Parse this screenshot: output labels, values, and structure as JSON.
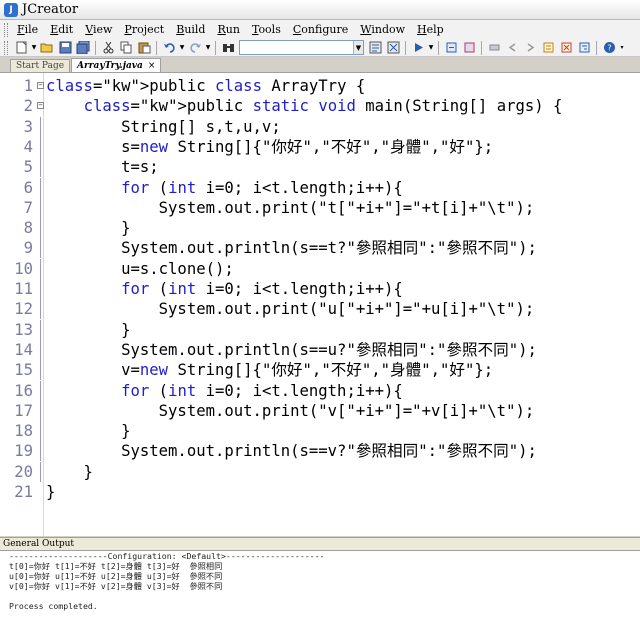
{
  "window": {
    "title": "JCreator"
  },
  "menu": [
    "File",
    "Edit",
    "View",
    "Project",
    "Build",
    "Run",
    "Tools",
    "Configure",
    "Window",
    "Help"
  ],
  "toolbar": {
    "icons": [
      "new-file-icon",
      "open-folder-icon",
      "save-icon",
      "save-all-icon",
      "cut-icon",
      "copy-icon",
      "paste-icon",
      "undo-icon",
      "redo-icon",
      "find-icon",
      "compile-file-icon",
      "build-project-icon",
      "run-icon",
      "debug-icon",
      "stop-icon",
      "toggle-breakpoint-icon",
      "bookmark-icon",
      "prev-bookmark-icon",
      "next-bookmark-icon",
      "clear-bookmarks-icon",
      "help-icon"
    ],
    "search_value": ""
  },
  "tabs": [
    {
      "label": "Start Page",
      "active": false
    },
    {
      "label": "ArrayTry.java",
      "active": true,
      "close": "×"
    }
  ],
  "editor": {
    "lines": [
      {
        "n": "1",
        "text": "public class ArrayTry {"
      },
      {
        "n": "2",
        "text": "    public static void main(String[] args) {"
      },
      {
        "n": "3",
        "text": "        String[] s,t,u,v;"
      },
      {
        "n": "4",
        "text": "        s=new String[]{\"你好\",\"不好\",\"身體\",\"好\"};"
      },
      {
        "n": "5",
        "text": "        t=s;"
      },
      {
        "n": "6",
        "text": "        for (int i=0; i<t.length;i++){"
      },
      {
        "n": "7",
        "text": "            System.out.print(\"t[\"+i+\"]=\"+t[i]+\"\\t\");"
      },
      {
        "n": "8",
        "text": "        }"
      },
      {
        "n": "9",
        "text": "        System.out.println(s==t?\"參照相同\":\"參照不同\");"
      },
      {
        "n": "10",
        "text": "        u=s.clone();"
      },
      {
        "n": "11",
        "text": "        for (int i=0; i<t.length;i++){"
      },
      {
        "n": "12",
        "text": "            System.out.print(\"u[\"+i+\"]=\"+u[i]+\"\\t\");"
      },
      {
        "n": "13",
        "text": "        }"
      },
      {
        "n": "14",
        "text": "        System.out.println(s==u?\"參照相同\":\"參照不同\");"
      },
      {
        "n": "15",
        "text": "        v=new String[]{\"你好\",\"不好\",\"身體\",\"好\"};"
      },
      {
        "n": "16",
        "text": "        for (int i=0; i<t.length;i++){"
      },
      {
        "n": "17",
        "text": "            System.out.print(\"v[\"+i+\"]=\"+v[i]+\"\\t\");"
      },
      {
        "n": "18",
        "text": "        }"
      },
      {
        "n": "19",
        "text": "        System.out.println(s==v?\"參照相同\":\"參照不同\");"
      },
      {
        "n": "20",
        "text": "    }"
      },
      {
        "n": "21",
        "text": "}"
      }
    ],
    "keywords": [
      "public",
      "class",
      "static",
      "void",
      "new",
      "for",
      "int"
    ],
    "keyword_color": "#2020c8",
    "line_number_color": "#7a7aa0"
  },
  "output": {
    "title": "General Output",
    "lines": [
      "--------------------Configuration: <Default>--------------------",
      "t[0]=你好 t[1]=不好 t[2]=身體 t[3]=好  參照相同",
      "u[0]=你好 u[1]=不好 u[2]=身體 u[3]=好  參照不同",
      "v[0]=你好 v[1]=不好 v[2]=身體 v[3]=好  參照不同",
      "",
      "Process completed."
    ]
  }
}
